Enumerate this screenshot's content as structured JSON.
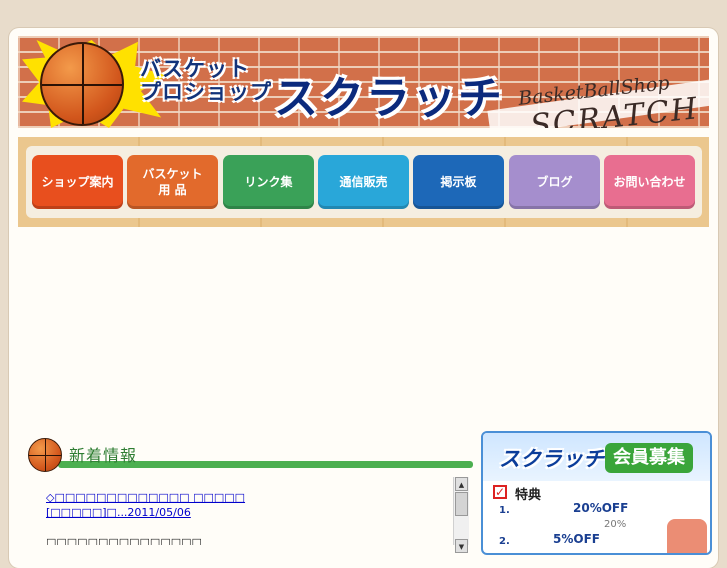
{
  "header": {
    "title_small_line1": "バスケット",
    "title_small_line2": "プロショップ",
    "title_big": "スクラッチ",
    "english_line1": "BasketBallShop",
    "english_line2": "SCRATCH"
  },
  "nav": {
    "items": [
      {
        "label": "ショップ案内",
        "color": "#e84f1e"
      },
      {
        "label": "バスケット\n用 品",
        "color": "#e26a2c"
      },
      {
        "label": "リンク集",
        "color": "#3aa158"
      },
      {
        "label": "通信販売",
        "color": "#29a7d9"
      },
      {
        "label": "掲示板",
        "color": "#1d68b8"
      },
      {
        "label": "ブログ",
        "color": "#a58ecd"
      },
      {
        "label": "お問い合わせ",
        "color": "#e86e90"
      }
    ]
  },
  "news": {
    "heading": "新着情報",
    "item1_link": "◇□□□□□□□□□□□□□ □□□□□",
    "item1_date": "[□□□□□]□...2011/05/06",
    "item2_text": "□□□□□□□□□□□□□□□"
  },
  "member": {
    "title1": "スクラッチ",
    "title2": "会員募集",
    "perk_label": "特典",
    "rows": [
      {
        "num": "1.",
        "value": "20%OFF",
        "sub": "20%"
      },
      {
        "num": "2.",
        "value": "5%OFF"
      }
    ]
  }
}
